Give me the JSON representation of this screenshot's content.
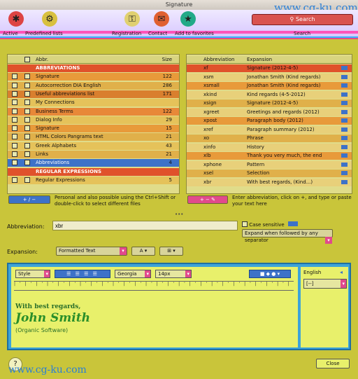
{
  "window": {
    "title": "Signature",
    "watermark_top": "www.cg-ku.com",
    "watermark_bottom": "www.cg-ku.com"
  },
  "toolbar": {
    "items": [
      {
        "label": "Active",
        "icon": "asterisk-icon"
      },
      {
        "label": "Predefined lists",
        "icon": "cog-icon"
      },
      {
        "label": "Registration",
        "icon": "key-icon"
      },
      {
        "label": "Contact",
        "icon": "contact-icon"
      },
      {
        "label": "Add to favorites",
        "icon": "star-icon"
      }
    ],
    "search_label": "Search",
    "search_sub": "Search"
  },
  "left_list": {
    "header": [
      "Abbr.",
      "Size"
    ],
    "rows": [
      {
        "type": "group",
        "label": "ABBREVIATIONS",
        "color": "#e0522b"
      },
      {
        "label": "Signature",
        "value": "122",
        "color": "#e89a3a"
      },
      {
        "label": "Autocorrection DIA English",
        "value": "286",
        "color": "#e0b04a"
      },
      {
        "label": "Useful abbreviations list",
        "value": "171",
        "color": "#d97f2e"
      },
      {
        "label": "My Connections",
        "value": "",
        "color": "#e5c25a"
      },
      {
        "label": "Business Terms",
        "value": "122",
        "color": "#e88838"
      },
      {
        "label": "Dialog Info",
        "value": "29",
        "color": "#e5c25a"
      },
      {
        "label": "Signature",
        "value": "15",
        "color": "#e89a3a"
      },
      {
        "label": "HTML Colors Pangrams text",
        "value": "21",
        "color": "#e0b04a"
      },
      {
        "label": "Greek Alphabets",
        "value": "43",
        "color": "#e5c25a"
      },
      {
        "label": "Links",
        "value": "21",
        "color": "#e0b04a"
      },
      {
        "label": "Abbreviations",
        "value": "4",
        "color": "#3d72c8"
      },
      {
        "type": "group",
        "label": "REGULAR EXPRESSIONS",
        "color": "#e0522b"
      },
      {
        "label": "Regular Expressions",
        "value": "5",
        "color": "#e5c25a"
      }
    ],
    "footer_text": "Personal and also possible using the Ctrl+Shift or double-click to select different files"
  },
  "right_list": {
    "header": [
      "Abbreviation",
      "Expansion"
    ],
    "rows": [
      {
        "abbr": "xf",
        "exp": "Signature (2012-4-5)",
        "color": "#e0522b"
      },
      {
        "abbr": "xsm",
        "exp": "Jonathan Smith (Kind regards)",
        "color": "#e8d07a"
      },
      {
        "abbr": "xsmall",
        "exp": "Jonathan Smith (Kind regards)",
        "color": "#e89a3a"
      },
      {
        "abbr": "xkind",
        "exp": "Kind regards (4-5-2012)",
        "color": "#e8d07a"
      },
      {
        "abbr": "xsign",
        "exp": "Signature (2012-4-5)",
        "color": "#e0b04a"
      },
      {
        "abbr": "xgreet",
        "exp": "Greetings and regards (2012)",
        "color": "#e8d07a"
      },
      {
        "abbr": "xpost",
        "exp": "Paragraph body (2012)",
        "color": "#e89a3a"
      },
      {
        "abbr": "xref",
        "exp": "Paragraph summary (2012)",
        "color": "#e8d07a"
      },
      {
        "abbr": "xo",
        "exp": "Phrase",
        "color": "#e0b04a"
      },
      {
        "abbr": "xinfo",
        "exp": "History",
        "color": "#e8d07a"
      },
      {
        "abbr": "xlb",
        "exp": "Thank you very much, the end",
        "color": "#e89a3a"
      },
      {
        "abbr": "xphone",
        "exp": "Pattern",
        "color": "#e8d07a"
      },
      {
        "abbr": "xsel",
        "exp": "Selection",
        "color": "#e0b04a"
      },
      {
        "abbr": "xbr",
        "exp": "With best regards, (Kind...)",
        "color": "#e8d07a"
      }
    ],
    "footer_text": "Enter abbreviation, click on +, and type or paste your text here"
  },
  "form": {
    "abbr_label": "Abbreviation:",
    "abbr_value": "xbr",
    "case_label": "Case sensitive",
    "expand_label": "Expand when followed by any separator",
    "expansion_label": "Expansion:",
    "format_value": "Formatted Text"
  },
  "editor": {
    "style_value": "Style",
    "font_value": "Georgia",
    "size_value": "14px",
    "english_label": "English",
    "lang_value": "[--]",
    "text_line1": "With best regards,",
    "text_line2": "John Smith",
    "text_line3": "(Organic Software)"
  },
  "close_label": "Close"
}
